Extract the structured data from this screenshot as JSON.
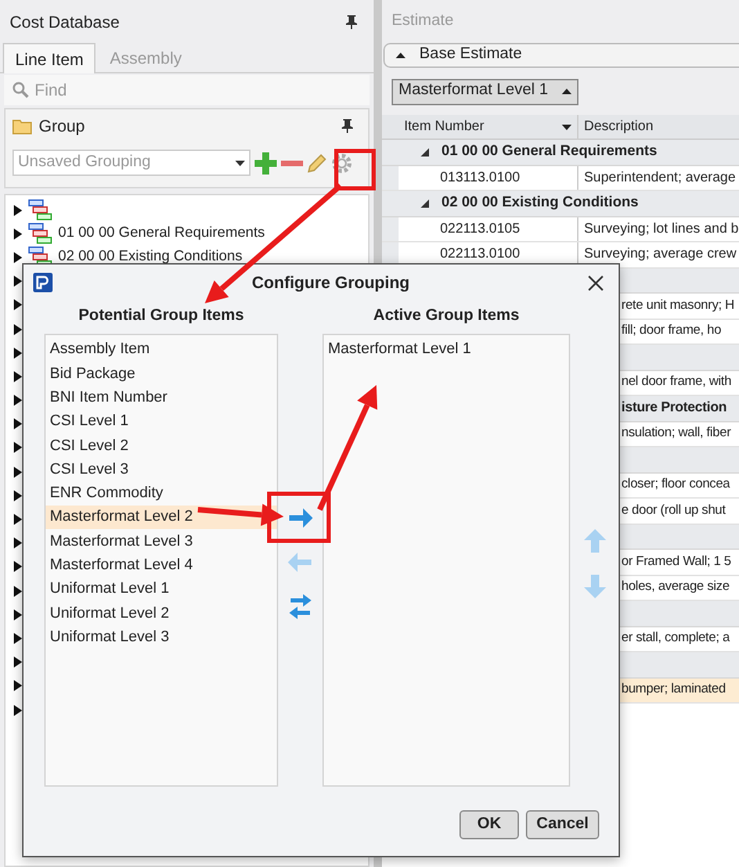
{
  "cost_database": {
    "title": "Cost Database",
    "tabs": [
      {
        "label": "Line Item",
        "selected": true
      },
      {
        "label": "Assembly",
        "selected": false
      }
    ],
    "search": {
      "placeholder": "Find"
    },
    "group_panel": {
      "title": "Group",
      "grouping": "Unsaved Grouping"
    },
    "tree": [
      {
        "expanded": false
      },
      {
        "label": "01 00 00 General Requirements",
        "expanded": false
      },
      {
        "label": "02 00 00 Existing Conditions",
        "expanded": false
      },
      {
        "expanded": false
      },
      {
        "expanded": false
      },
      {
        "expanded": false
      },
      {
        "expanded": false
      },
      {
        "expanded": false
      },
      {
        "expanded": false
      },
      {
        "expanded": false
      },
      {
        "expanded": false
      },
      {
        "expanded": false
      },
      {
        "expanded": false
      },
      {
        "expanded": false
      },
      {
        "expanded": false
      },
      {
        "expanded": false
      },
      {
        "expanded": false
      },
      {
        "expanded": false
      },
      {
        "expanded": false
      },
      {
        "expanded": false
      },
      {
        "expanded": false
      },
      {
        "expanded": false
      }
    ]
  },
  "estimate": {
    "title": "Estimate",
    "section": {
      "label": "Base Estimate",
      "expanded": true
    },
    "group_by": "Masterformat Level 1",
    "columns": [
      "Item Number",
      "Description"
    ],
    "rows": [
      {
        "kind": "group",
        "label": "01 00 00 General Requirements",
        "expanded": true
      },
      {
        "kind": "item",
        "item_number": "013113.0100",
        "description": "Superintendent; average"
      },
      {
        "kind": "group",
        "label": "02 00 00 Existing Conditions",
        "expanded": true
      },
      {
        "kind": "item",
        "item_number": "022113.0105",
        "description": "Surveying; lot lines and b"
      },
      {
        "kind": "item",
        "item_number": "022113.0100",
        "description": "Surveying; average crew"
      },
      {
        "kind": "group_cut"
      },
      {
        "kind": "item_cut",
        "description": "rete unit masonry; H"
      },
      {
        "kind": "item_cut",
        "description": "fill; door frame, ho"
      },
      {
        "kind": "group_cut"
      },
      {
        "kind": "item_cut",
        "description": "nel door frame, with"
      },
      {
        "kind": "group_cut",
        "label": "isture Protection"
      },
      {
        "kind": "item_cut",
        "description": "nsulation; wall, fiber"
      },
      {
        "kind": "group_cut"
      },
      {
        "kind": "item_cut",
        "description": "closer; floor concea"
      },
      {
        "kind": "item_cut",
        "description": "e door (roll up shut"
      },
      {
        "kind": "group_cut"
      },
      {
        "kind": "item_cut",
        "description": "or Framed Wall; 1 5"
      },
      {
        "kind": "item_cut",
        "description": "holes, average size"
      },
      {
        "kind": "group_cut"
      },
      {
        "kind": "item_cut",
        "description": "er stall, complete; a"
      },
      {
        "kind": "group_cut"
      },
      {
        "kind": "item_cut",
        "description": "bumper; laminated",
        "selected": true
      }
    ]
  },
  "dialog": {
    "title": "Configure Grouping",
    "potential_header": "Potential Group Items",
    "potential": [
      {
        "label": "Assembly Item",
        "selected": false
      },
      {
        "label": "Bid Package",
        "selected": false
      },
      {
        "label": "BNI Item Number",
        "selected": false
      },
      {
        "label": "CSI Level 1",
        "selected": false
      },
      {
        "label": "CSI Level 2",
        "selected": false
      },
      {
        "label": "CSI Level 3",
        "selected": false
      },
      {
        "label": "ENR Commodity",
        "selected": false
      },
      {
        "label": "Masterformat Level 2",
        "selected": true
      },
      {
        "label": "Masterformat Level 3",
        "selected": false
      },
      {
        "label": "Masterformat Level 4",
        "selected": false
      },
      {
        "label": "Uniformat Level 1",
        "selected": false
      },
      {
        "label": "Uniformat Level 2",
        "selected": false
      },
      {
        "label": "Uniformat Level 3",
        "selected": false
      }
    ],
    "active_header": "Active Group Items",
    "active": [
      {
        "label": "Masterformat Level 1",
        "selected": false
      }
    ],
    "movers": [
      {
        "kind": "add",
        "disabled": false
      },
      {
        "kind": "remove",
        "disabled": true
      },
      {
        "kind": "swap",
        "disabled": false
      }
    ],
    "order": [
      {
        "kind": "up",
        "disabled": true
      },
      {
        "kind": "down",
        "disabled": true
      }
    ],
    "buttons": [
      "OK",
      "Cancel"
    ]
  }
}
